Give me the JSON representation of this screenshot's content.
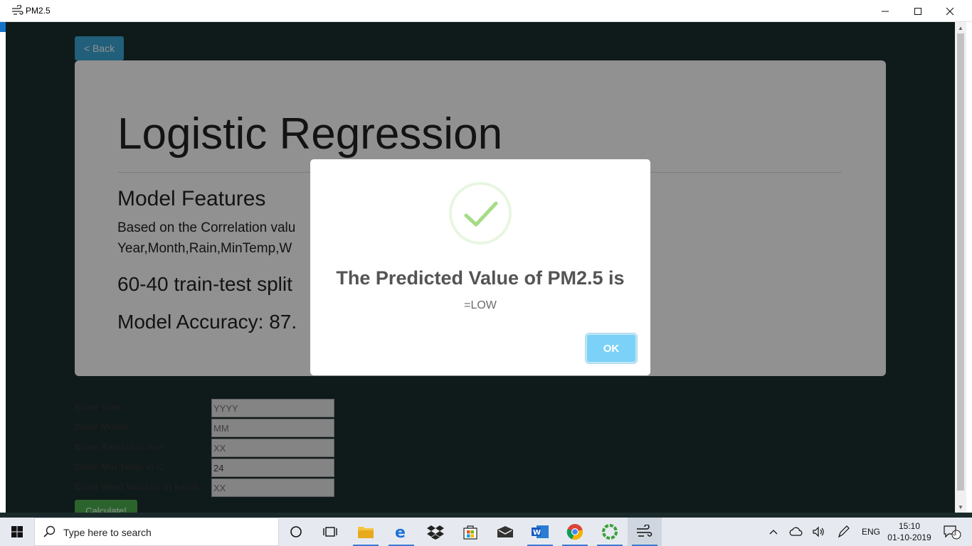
{
  "window": {
    "title": "PM2.5",
    "minimize": "—",
    "maximize": "☐",
    "close": "✕"
  },
  "page": {
    "back_label": "< Back",
    "heading": "Logistic Regression",
    "features_heading": "Model Features",
    "features_text_line1": "Based on the Correlation valu",
    "features_text_line2": "Year,Month,Rain,MinTemp,W",
    "split": "60-40 train-test split",
    "accuracy": "Model Accuracy: 87."
  },
  "form": {
    "year_label": "Enter Year",
    "year_placeholder": "YYYY",
    "month_label": "Enter Month",
    "month_placeholder": "MM",
    "rain_label": "Enter Rainfall in mm",
    "rain_placeholder": "XX",
    "temp_label": "Enter Min Temp in C",
    "temp_value": "24",
    "wind_label": "Enter Wind Velocity in kmph",
    "wind_placeholder": "XX",
    "calculate_label": "Calculate!"
  },
  "modal": {
    "title": "The Predicted Value of PM2.5 is",
    "text": "=LOW",
    "ok_label": "OK",
    "check_color": "#a5dc86"
  },
  "taskbar": {
    "search_placeholder": "Type here to search",
    "language": "ENG",
    "time": "15:10",
    "date": "01-10-2019",
    "notification_count": "3"
  }
}
